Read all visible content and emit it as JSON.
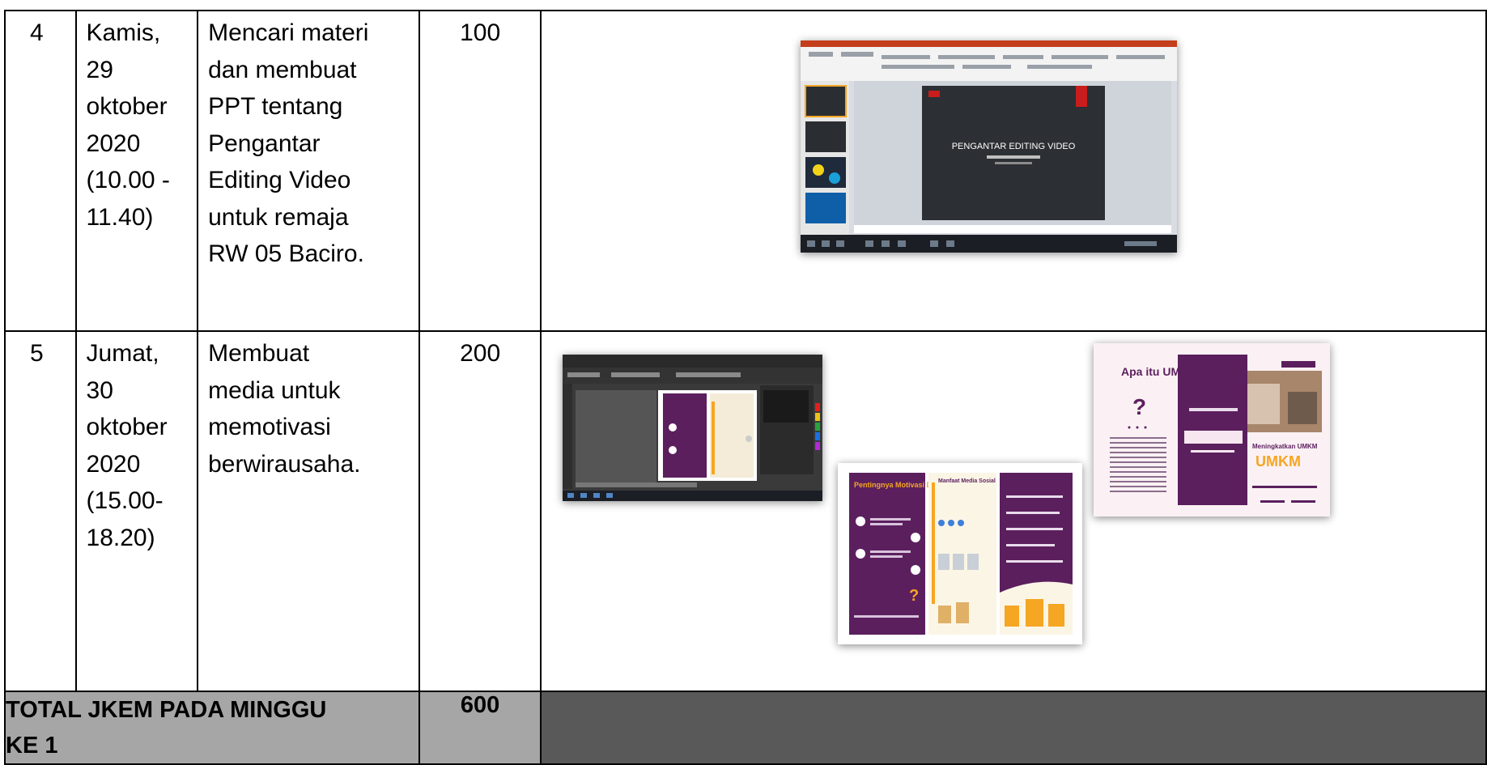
{
  "rows": [
    {
      "no": "4",
      "date_lines": [
        "Kamis,",
        "29",
        "oktober",
        "2020",
        "(10.00 -",
        "11.40)"
      ],
      "activity_lines": [
        "Mencari materi",
        "dan membuat",
        "PPT tentang",
        "Pengantar",
        "Editing Video",
        "untuk remaja",
        "RW 05 Baciro."
      ],
      "jkem": "100",
      "doc": {
        "ppt_slide_title": "PENGANTAR EDITING VIDEO"
      }
    },
    {
      "no": "5",
      "date_lines": [
        "Jumat,",
        "30",
        "oktober",
        "2020",
        "(15.00-",
        "18.20)"
      ],
      "activity_lines": [
        "Membuat",
        "media untuk",
        "memotivasi",
        "berwirausaha."
      ],
      "jkem": "200",
      "doc": {
        "brochure_left_title": "Pentingnya Motivasi Diri",
        "brochure_mid_title": "Manfaat Media Sosial",
        "brochure_q_title": "Apa itu UMKM",
        "brochure_right_title": "Meningkatkan UMKM"
      }
    }
  ],
  "total": {
    "label_lines": [
      "TOTAL JKEM PADA MINGGU",
      "KE 1"
    ],
    "value": "600"
  },
  "colors": {
    "purple": "#5b1f5e",
    "orange": "#f5a623",
    "total_bg": "#a6a6a6",
    "total_dark": "#595959"
  }
}
